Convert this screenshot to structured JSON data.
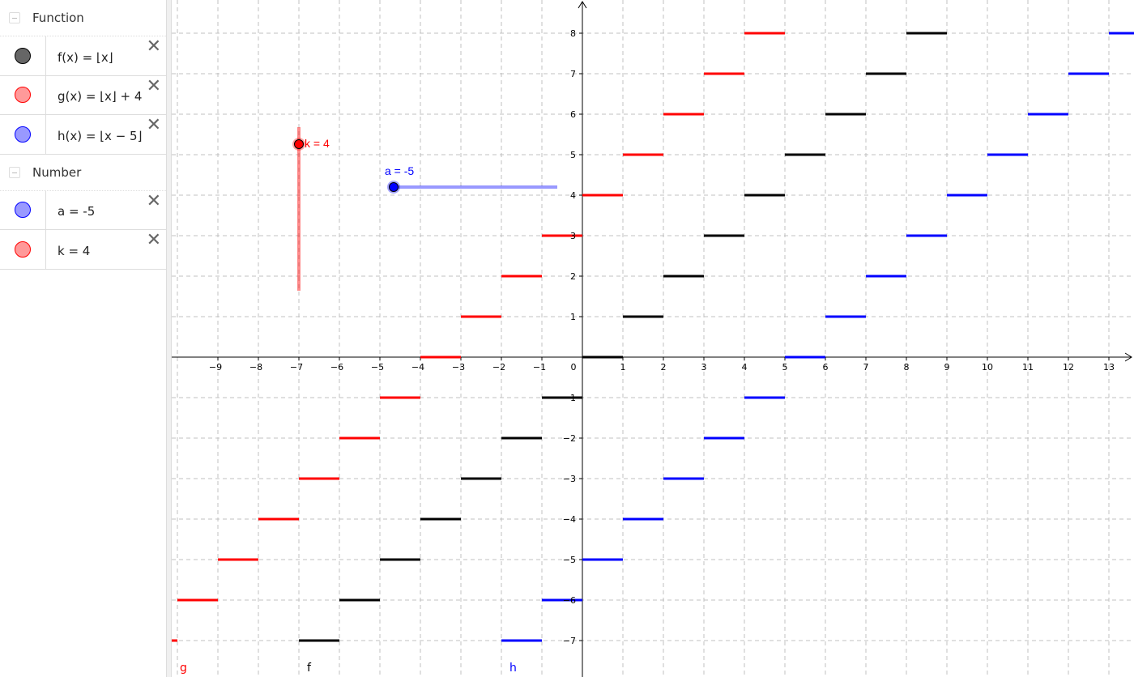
{
  "sidebar": {
    "groups": [
      {
        "title": "Function",
        "items": [
          {
            "label": "f(x) = ⌊x⌋",
            "color": "#666666",
            "border": "#000000"
          },
          {
            "label": "g(x) = ⌊x⌋ + 4",
            "color": "#ff9999",
            "border": "#ff0000"
          },
          {
            "label": "h(x) = ⌊x − 5⌋",
            "color": "#9999ff",
            "border": "#0000ff"
          }
        ]
      },
      {
        "title": "Number",
        "items": [
          {
            "label": "a = -5",
            "color": "#9999ff",
            "border": "#0000ff"
          },
          {
            "label": "k = 4",
            "color": "#ff9999",
            "border": "#ff0000"
          }
        ]
      }
    ],
    "close_glyph": "✕"
  },
  "chart_data": {
    "type": "line",
    "grid": true,
    "xlim": [
      -10.14,
      13.62
    ],
    "ylim": [
      -7.9,
      8.82
    ],
    "xticks": [
      -9,
      -8,
      -7,
      -6,
      -5,
      -4,
      -3,
      -2,
      -1,
      0,
      1,
      2,
      3,
      4,
      5,
      6,
      7,
      8,
      9,
      10,
      11,
      12,
      13
    ],
    "yticks": [
      -7,
      -6,
      -5,
      -4,
      -3,
      -2,
      -1,
      1,
      2,
      3,
      4,
      5,
      6,
      7,
      8
    ],
    "series": [
      {
        "name": "f",
        "definition": "floor(x)",
        "hshift": 0,
        "vshift": 0,
        "color": "#000000",
        "label_x": -7
      },
      {
        "name": "g",
        "definition": "floor(x) + 4",
        "hshift": 0,
        "vshift": 4,
        "color": "#ff0000",
        "label_x": -10
      },
      {
        "name": "h",
        "definition": "floor(x - 5)",
        "hshift": 5,
        "vshift": 0,
        "color": "#0000ff",
        "label_x": -2
      }
    ]
  },
  "sliders": {
    "k": {
      "label": "k = 4",
      "value": 4,
      "color": "#ff0000"
    },
    "a": {
      "label": "a = -5",
      "value": -5,
      "color": "#0000ff"
    }
  }
}
